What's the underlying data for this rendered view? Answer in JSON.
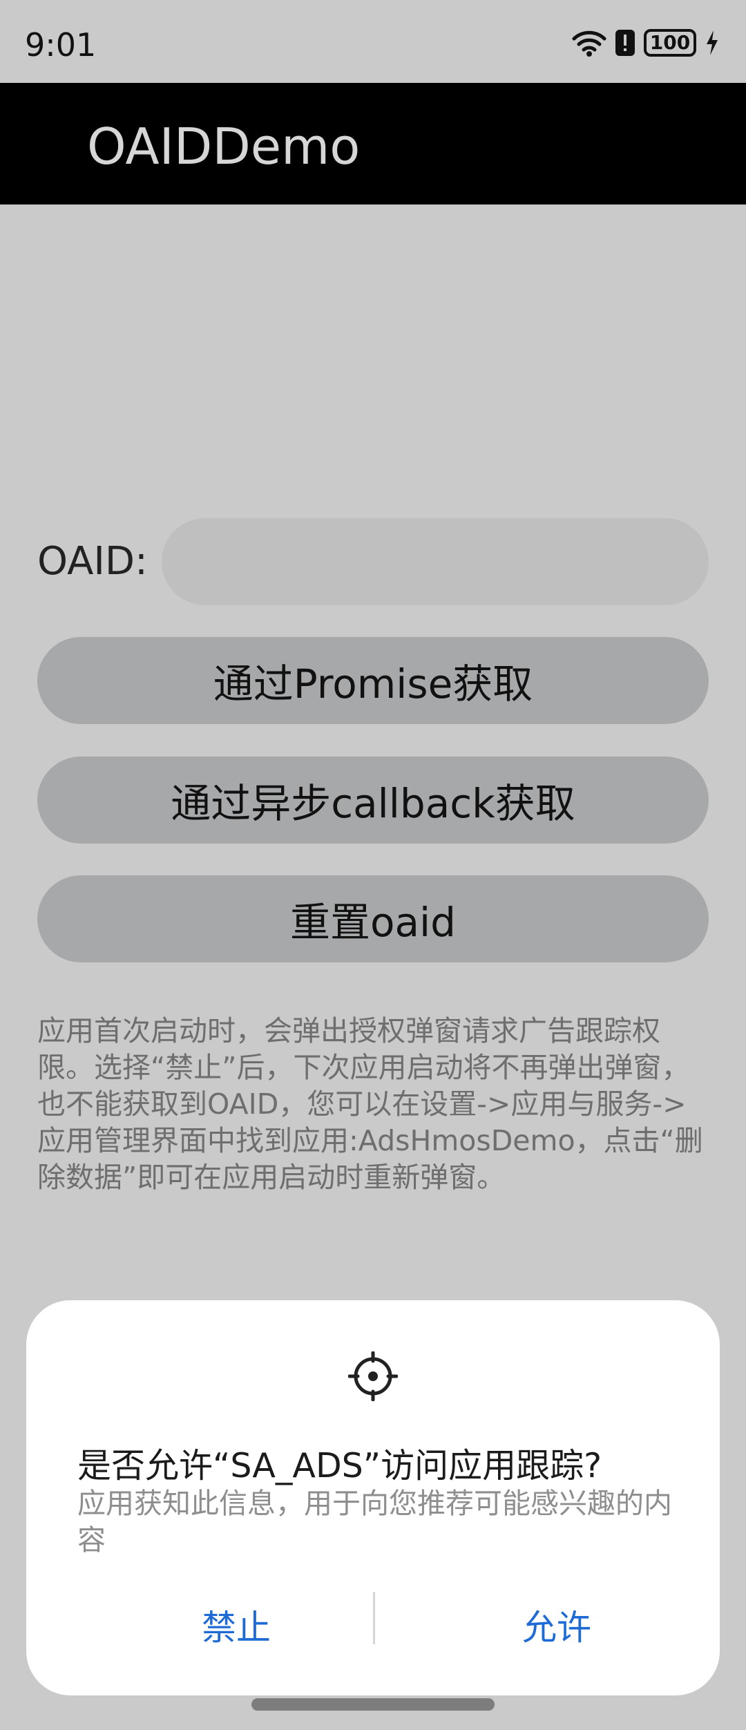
{
  "status_bar": {
    "time": "9:01",
    "battery": "100"
  },
  "app_bar": {
    "title": "OAIDDemo"
  },
  "oaid": {
    "label": "OAID:",
    "value": ""
  },
  "buttons": {
    "promise": "通过Promise获取",
    "callback": "通过异步callback获取",
    "reset": "重置oaid"
  },
  "notice": "应用首次启动时，会弹出授权弹窗请求广告跟踪权限。选择“禁止”后，下次应用启动将不再弹出弹窗，也不能获取到OAID，您可以在设置->应用与服务->应用管理界面中找到应用:AdsHmosDemo，点击“删除数据”即可在应用启动时重新弹窗。",
  "dialog": {
    "icon": "target-crosshair-icon",
    "title": "是否允许“SA_ADS”访问应用跟踪?",
    "description": "应用获知此信息，用于向您推荐可能感兴趣的内容",
    "deny_label": "禁止",
    "allow_label": "允许",
    "accent_color": "#1f6bd6"
  },
  "colors": {
    "background": "#cacaca",
    "app_bar": "#000000",
    "button": "#a7a8aa"
  }
}
